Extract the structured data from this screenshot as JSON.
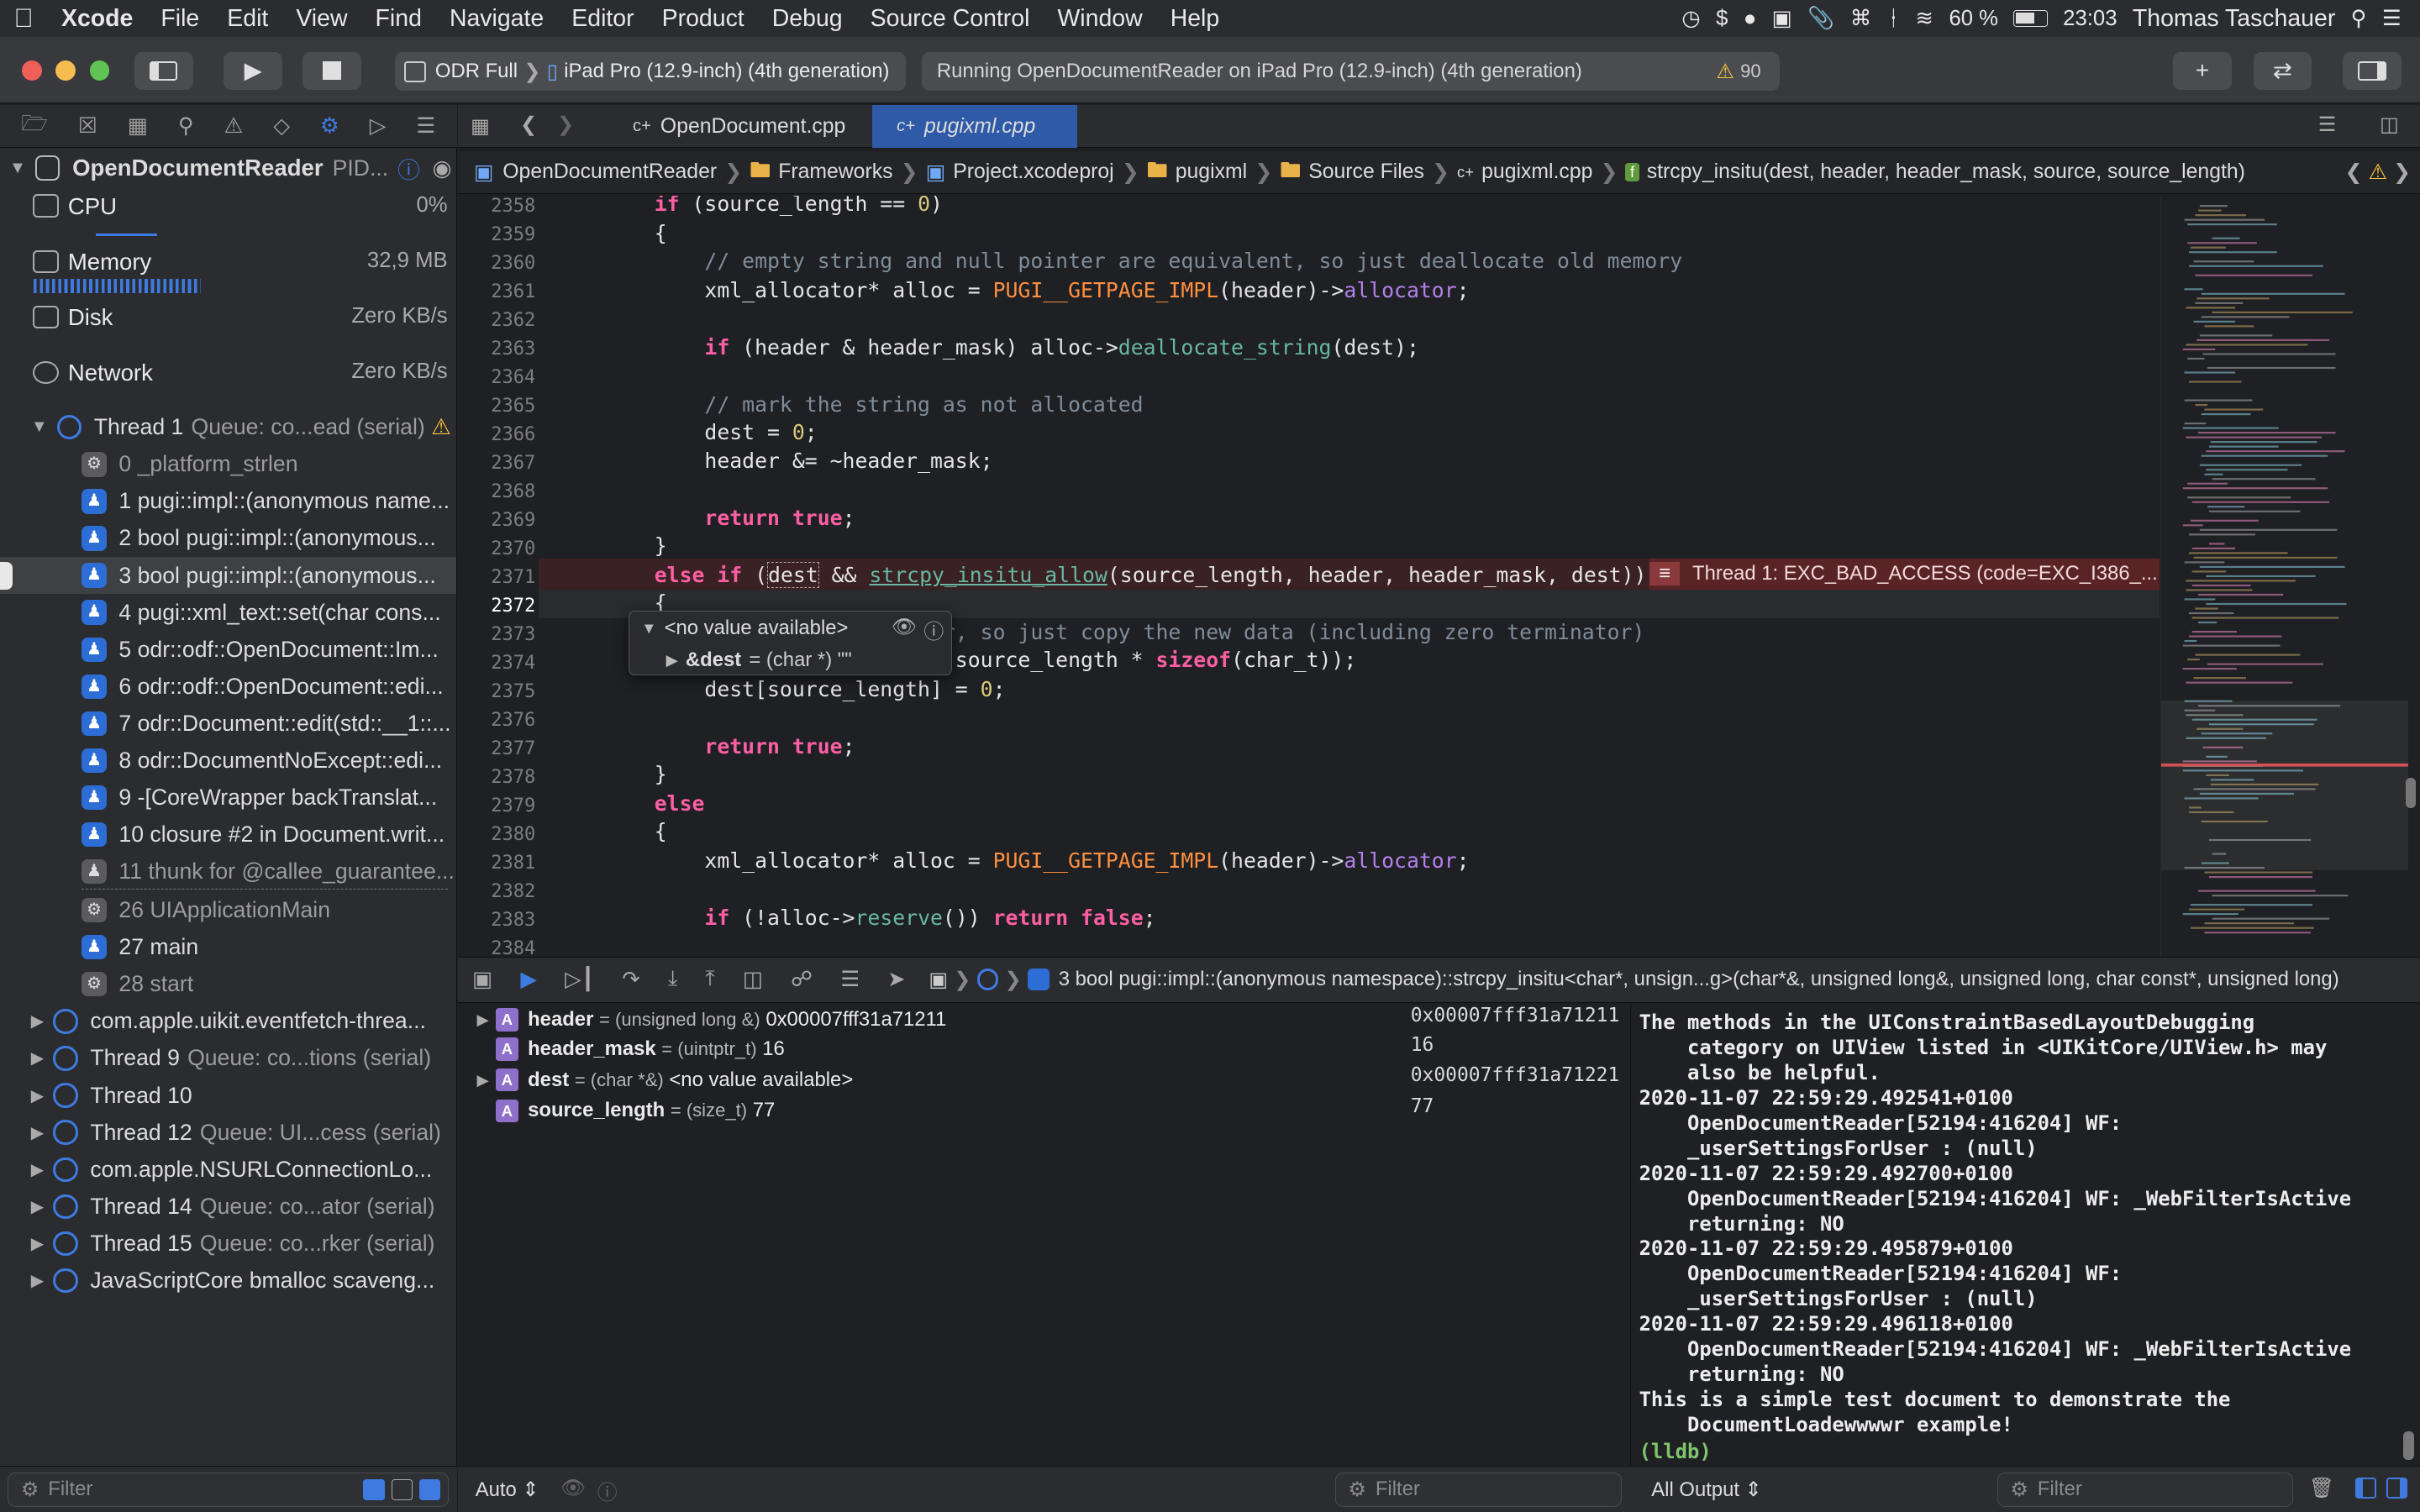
{
  "menubar": {
    "app": "Xcode",
    "items": [
      "File",
      "Edit",
      "View",
      "Find",
      "Navigate",
      "Editor",
      "Product",
      "Debug",
      "Source Control",
      "Window",
      "Help"
    ],
    "battery": "60 %",
    "clock": "23:03",
    "user": "Thomas Taschauer"
  },
  "toolbar": {
    "scheme": "ODR Full",
    "destination": "iPad Pro (12.9-inch) (4th generation)",
    "activity": "Running OpenDocumentReader on iPad Pro (12.9-inch) (4th generation)",
    "warnings": "90"
  },
  "navigator": {
    "project": "OpenDocumentReader",
    "project_pid": "PID...",
    "gauges": [
      {
        "label": "CPU",
        "value": "0%"
      },
      {
        "label": "Memory",
        "value": "32,9 MB"
      },
      {
        "label": "Disk",
        "value": "Zero KB/s"
      },
      {
        "label": "Network",
        "value": "Zero KB/s"
      }
    ],
    "thread1": {
      "name": "Thread 1",
      "queue": "Queue: co...ead (serial)"
    },
    "frames": [
      "0 _platform_strlen",
      "1 pugi::impl::(anonymous name...",
      "2 bool pugi::impl::(anonymous...",
      "3 bool pugi::impl::(anonymous...",
      "4 pugi::xml_text::set(char cons...",
      "5 odr::odf::OpenDocument::Im...",
      "6 odr::odf::OpenDocument::edi...",
      "7 odr::Document::edit(std::__1::...",
      "8 odr::DocumentNoExcept::edi...",
      "9 -[CoreWrapper backTranslat...",
      "10 closure #2 in Document.writ...",
      "11 thunk for @callee_guarantee...",
      "26 UIApplicationMain",
      "27 main",
      "28 start"
    ],
    "threads": [
      {
        "name": "com.apple.uikit.eventfetch-threa...",
        "queue": ""
      },
      {
        "name": "Thread 9",
        "queue": "Queue: co...tions (serial)"
      },
      {
        "name": "Thread 10",
        "queue": ""
      },
      {
        "name": "Thread 12",
        "queue": "Queue: UI...cess (serial)"
      },
      {
        "name": "com.apple.NSURLConnectionLo...",
        "queue": ""
      },
      {
        "name": "Thread 14",
        "queue": "Queue: co...ator (serial)"
      },
      {
        "name": "Thread 15",
        "queue": "Queue: co...rker (serial)"
      },
      {
        "name": "JavaScriptCore bmalloc scaveng...",
        "queue": ""
      }
    ],
    "filter_placeholder": "Filter"
  },
  "tabs": [
    {
      "label": "OpenDocument.cpp"
    },
    {
      "label": "pugixml.cpp"
    }
  ],
  "jumpbar": [
    "OpenDocumentReader",
    "Frameworks",
    "Project.xcodeproj",
    "pugixml",
    "Source Files",
    "pugixml.cpp",
    "strcpy_insitu(dest, header, header_mask, source, source_length)"
  ],
  "editor": {
    "line_numbers": [
      "2358",
      "2359",
      "2360",
      "2361",
      "2362",
      "2363",
      "2364",
      "2365",
      "2366",
      "2367",
      "2368",
      "2369",
      "2370",
      "2371",
      "2372",
      "2373",
      "2374",
      "2375",
      "2376",
      "2377",
      "2378",
      "2379",
      "2380",
      "2381",
      "2382",
      "2383",
      "2384"
    ],
    "error_message": "Thread 1: EXC_BAD_ACCESS (code=EXC_I386_..."
  },
  "popover": {
    "summary": "<no value available>",
    "child_name": "&dest",
    "child_value": "= (char *) \"\""
  },
  "debugbar": {
    "frame": "3 bool pugi::impl::(anonymous namespace)::strcpy_insitu<char*, unsign...g>(char*&, unsigned long&, unsigned long, char const*, unsigned long)"
  },
  "variables": [
    {
      "name": "header",
      "type": "= (unsigned long &)",
      "value": "0x00007fff31a71211",
      "raw": "0x00007fff31a71211"
    },
    {
      "name": "header_mask",
      "type": "= (uintptr_t)",
      "value": "16",
      "raw": "16"
    },
    {
      "name": "dest",
      "type": "= (char *&)",
      "value": "<no value available>",
      "raw": "0x00007fff31a71221"
    },
    {
      "name": "source_length",
      "type": "= (size_t)",
      "value": "77",
      "raw": "77"
    }
  ],
  "console": {
    "lines": [
      "The methods in the UIConstraintBasedLayoutDebugging",
      "    category on UIView listed in <UIKitCore/UIView.h> may",
      "    also be helpful.",
      "2020-11-07 22:59:29.492541+0100",
      "    OpenDocumentReader[52194:416204] WF:",
      "    _userSettingsForUser : (null)",
      "2020-11-07 22:59:29.492700+0100",
      "    OpenDocumentReader[52194:416204] WF: _WebFilterIsActive",
      "    returning: NO",
      "2020-11-07 22:59:29.495879+0100",
      "    OpenDocumentReader[52194:416204] WF:",
      "    _userSettingsForUser : (null)",
      "2020-11-07 22:59:29.496118+0100",
      "    OpenDocumentReader[52194:416204] WF: _WebFilterIsActive",
      "    returning: NO",
      "This is a simple test document to demonstrate the",
      "    DocumentLoadewwwwr example!"
    ],
    "prompt": "(lldb)",
    "output_select": "All Output",
    "filter_placeholder": "Filter"
  },
  "variables_bar": {
    "mode": "Auto",
    "filter_placeholder": "Filter"
  },
  "colors": {
    "accent": "#3f7ae0",
    "error": "#d0484c",
    "warning": "#f5c33b"
  }
}
